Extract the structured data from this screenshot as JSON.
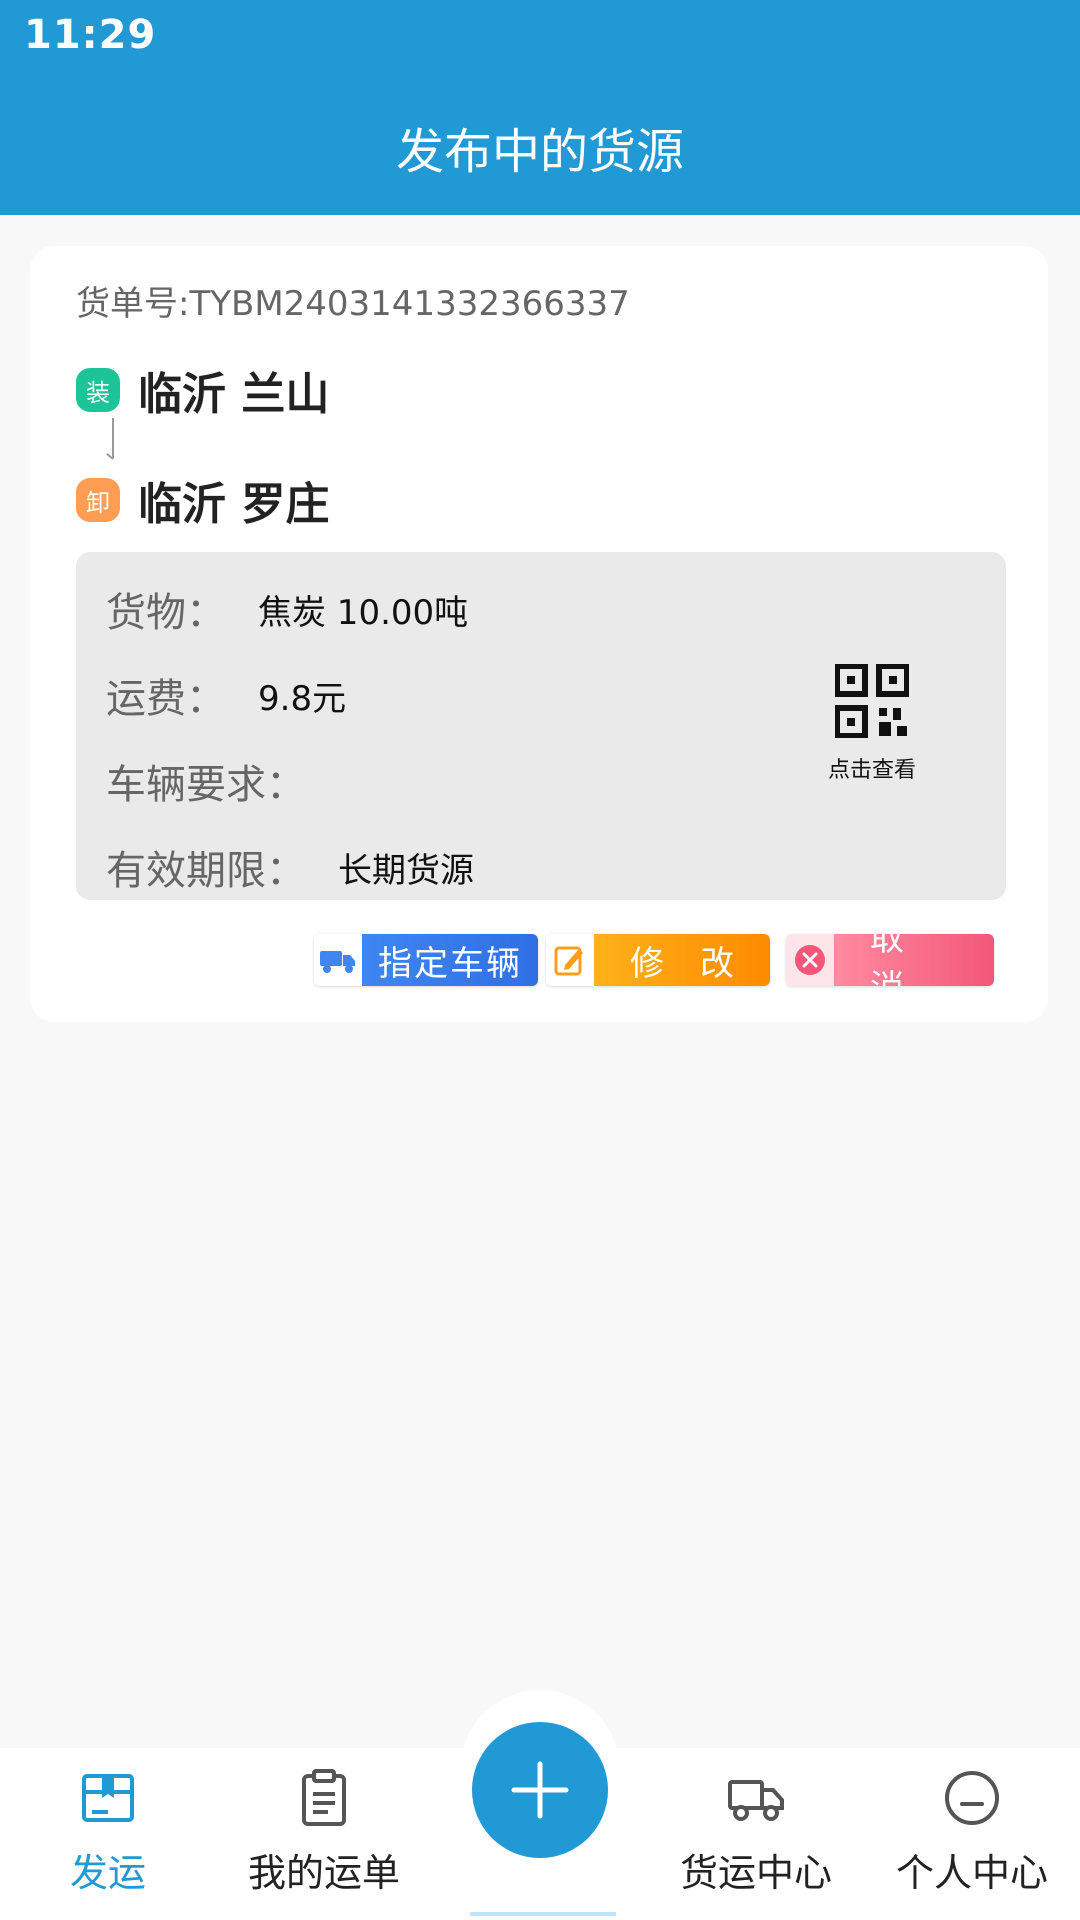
{
  "status_bar": {
    "time": "11:29"
  },
  "header": {
    "title": "发布中的货源"
  },
  "card": {
    "order_number": "货单号:TYBM2403141332366337",
    "load": {
      "badge": "装",
      "place": "临沂 兰山"
    },
    "unload": {
      "badge": "卸",
      "place": "临沂 罗庄"
    },
    "info": {
      "goods_label": "货物：",
      "goods_value": "焦炭 10.00吨",
      "freight_label": "运费：",
      "freight_value": "9.8元",
      "vehicle_label": "车辆要求：",
      "validity_label": "有效期限：",
      "validity_value": "长期货源"
    },
    "qr": {
      "caption": "点击查看",
      "icon": "qr-code-icon"
    },
    "buttons": {
      "assign_label": "指定车辆",
      "edit_label": "修改",
      "cancel_label": "取消"
    }
  },
  "bottom_nav": {
    "items": [
      {
        "label": "发运",
        "icon": "ship-box-icon",
        "active": true
      },
      {
        "label": "我的运单",
        "icon": "clipboard-icon",
        "active": false
      },
      {
        "label": "货运中心",
        "icon": "truck-icon",
        "active": false
      },
      {
        "label": "个人中心",
        "icon": "profile-icon",
        "active": false
      }
    ],
    "fab_icon": "plus-icon"
  },
  "colors": {
    "primary": "#2199d4",
    "load_badge": "#1dc497",
    "unload_badge": "#ff9d52",
    "assign_button": "#3f86f2",
    "edit_button": "#ff8a00",
    "cancel_button": "#f2577a"
  }
}
